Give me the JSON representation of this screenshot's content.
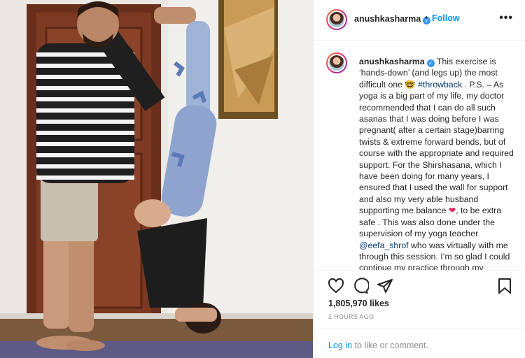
{
  "post": {
    "username": "anushkasharma",
    "follow_label": "Follow",
    "dot": "•",
    "more_label": "•••"
  },
  "caption": {
    "username": "anushkasharma",
    "text_1": "This exercise is ‘hands-down’ (and legs up) the most difficult one ",
    "emoji_1": "🤓",
    "hashtag": "#throwback",
    "text_2": " . P.S. – As yoga is a big part of my life, my doctor recommended that I can do all such asanas that I was doing before I was pregnant( after a certain stage)barring twists & extreme forward bends, but of course with the appropriate and required support. For the Shirshasana, which I have been doing for many years, I ensured that I used the wall for support and also my very able husband supporting me balance ",
    "heart": "❤",
    "text_3": ", to be extra safe . This was also done under the supervision of my yoga teacher ",
    "mention": "@eefa_shrof",
    "text_4": " who was virtually with me through this session. I’m so glad I could continue my practice through my pregnancy"
  },
  "stats": {
    "likes": "1,805,970 likes",
    "time": "2 HOURS AGO"
  },
  "login": {
    "link": "Log in",
    "rest": " to like or comment."
  },
  "icons": {
    "like": "heart-outline-icon",
    "comment": "comment-bubble-icon",
    "share": "paper-plane-icon",
    "save": "bookmark-icon"
  },
  "colors": {
    "link_blue": "#0095f6",
    "verified_blue": "#3897f0",
    "text": "#262626",
    "muted": "#8e8e8e"
  }
}
